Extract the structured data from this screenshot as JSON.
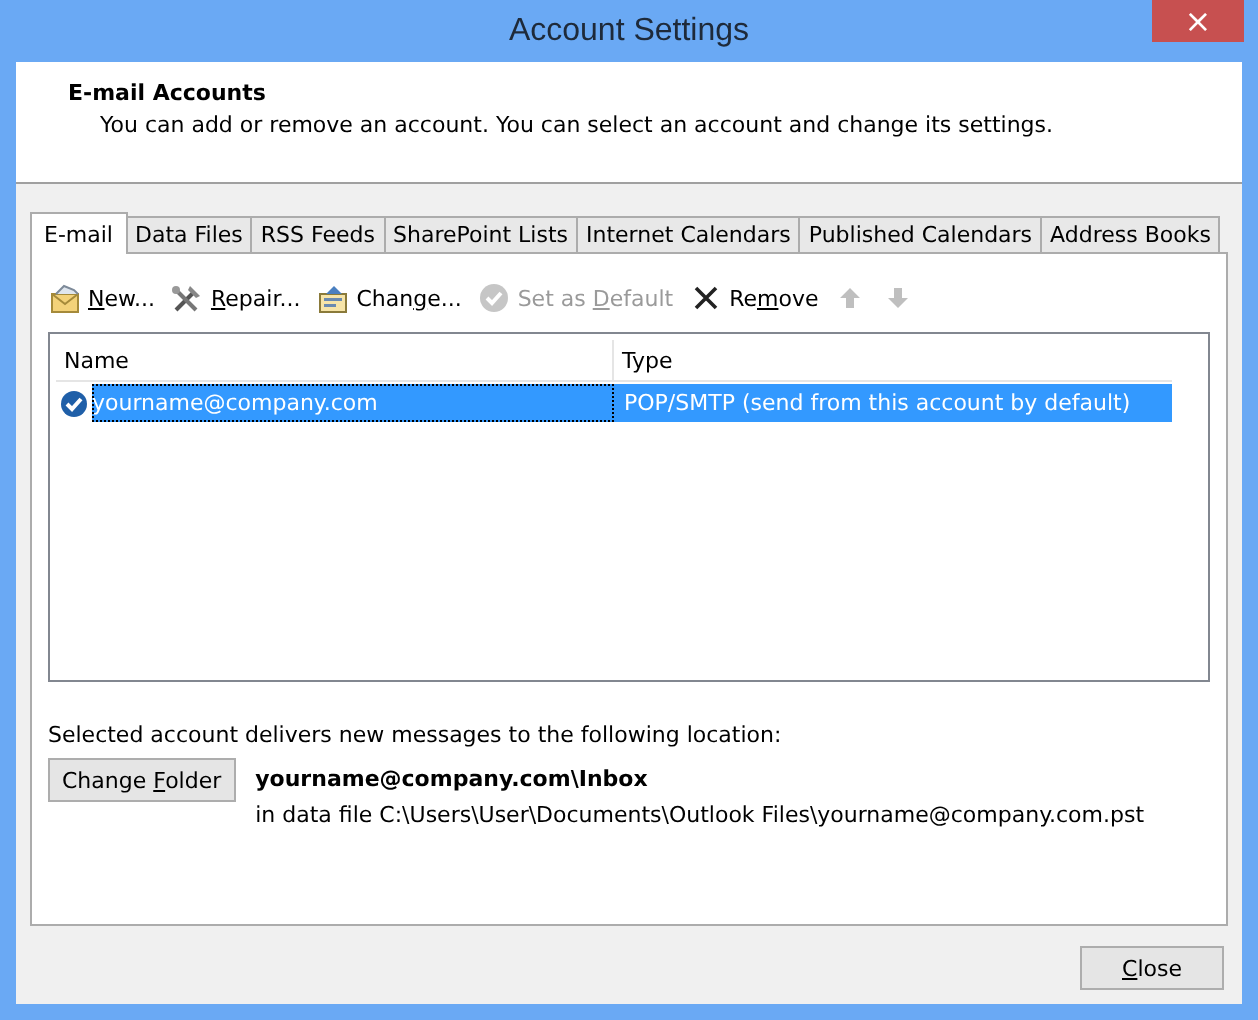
{
  "window": {
    "title": "Account Settings",
    "close": "×"
  },
  "header": {
    "title": "E-mail Accounts",
    "description": "You can add or remove an account. You can select an account and change its settings."
  },
  "tabs": [
    {
      "label": "E-mail",
      "selected": true
    },
    {
      "label": "Data Files",
      "selected": false
    },
    {
      "label": "RSS Feeds",
      "selected": false
    },
    {
      "label": "SharePoint Lists",
      "selected": false
    },
    {
      "label": "Internet Calendars",
      "selected": false
    },
    {
      "label": "Published Calendars",
      "selected": false
    },
    {
      "label": "Address Books",
      "selected": false
    }
  ],
  "toolbar": [
    {
      "kind": "new",
      "key": "N",
      "after": "ew...",
      "disabled": false
    },
    {
      "kind": "repair",
      "key": "R",
      "after": "epair...",
      "disabled": false
    },
    {
      "kind": "change",
      "before": "Chan",
      "key": "g",
      "after": "e...",
      "disabled": false
    },
    {
      "kind": "default",
      "before": "Set as ",
      "key": "D",
      "after": "efault",
      "disabled": true
    },
    {
      "kind": "remove",
      "before": "Re",
      "key": "m",
      "after": "ove",
      "disabled": false
    },
    {
      "kind": "up",
      "disabled": true
    },
    {
      "kind": "down",
      "disabled": true
    }
  ],
  "table": {
    "columns": [
      "Name",
      "Type"
    ],
    "rows": [
      {
        "name": "yourname@company.com",
        "type": "POP/SMTP (send from this account by default)",
        "selected": true,
        "default": true
      }
    ]
  },
  "delivery": {
    "label": "Selected account delivers new messages to the following location:",
    "button": {
      "before": "Change ",
      "key": "F",
      "after": "older"
    },
    "folder": "yourname@company.com\\Inbox",
    "data_file": "in data file C:\\Users\\User\\Documents\\Outlook Files\\yourname@company.com.pst"
  },
  "buttons": [
    {
      "key": "C",
      "after": "lose"
    }
  ]
}
